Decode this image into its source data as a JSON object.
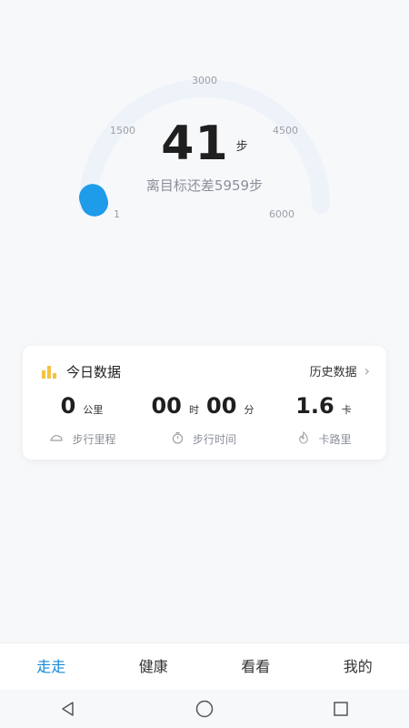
{
  "gauge": {
    "ticks": [
      "3000",
      "1500",
      "4500",
      "1",
      "6000"
    ],
    "steps": "41",
    "unit": "步",
    "goal_text": "离目标还差5959步",
    "progress": 0.007,
    "track_color": "#eef3fa",
    "accent_color": "#1e9be9"
  },
  "card": {
    "title": "今日数据",
    "history_label": "历史数据",
    "metrics": [
      {
        "value": "0",
        "unit": "公里",
        "label": "步行里程",
        "icon": "shoe-icon"
      },
      {
        "value1": "00",
        "unit1": "时",
        "value2": "00",
        "unit2": "分",
        "label": "步行时间",
        "icon": "stopwatch-icon"
      },
      {
        "value": "1.6",
        "unit": "卡",
        "label": "卡路里",
        "icon": "flame-icon"
      }
    ]
  },
  "tabs": [
    {
      "label": "走走",
      "active": true
    },
    {
      "label": "健康",
      "active": false
    },
    {
      "label": "看看",
      "active": false
    },
    {
      "label": "我的",
      "active": false
    }
  ],
  "system_nav": [
    "back-icon",
    "home-icon",
    "recents-icon"
  ]
}
